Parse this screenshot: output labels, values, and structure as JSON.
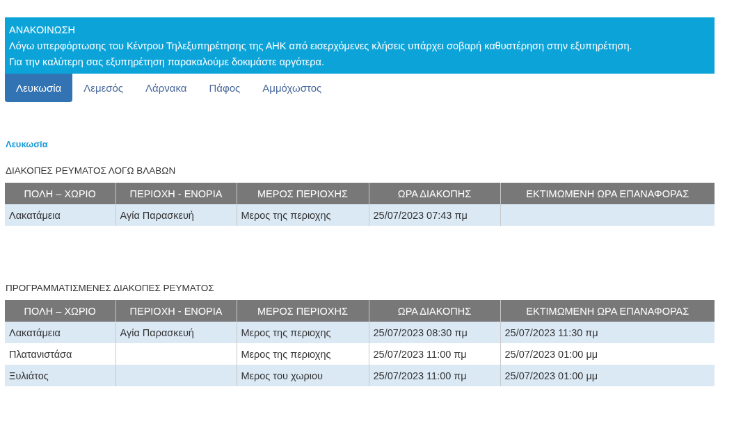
{
  "announcement": {
    "title": "ΑΝΑΚΟΙΝΩΣΗ",
    "lines": [
      "Λόγω υπερφόρτωσης του Κέντρου Τηλεξυπηρέτησης της ΑΗΚ από εισερχόμενες κλήσεις υπάρχει σοβαρή καθυστέρηση στην εξυπηρέτηση.",
      "Για την καλύτερη σας εξυπηρέτηση παρακαλούμε δοκιμάστε αργότερα."
    ]
  },
  "tabs": [
    {
      "label": "Λευκωσία",
      "selected": true
    },
    {
      "label": "Λεμεσός",
      "selected": false
    },
    {
      "label": "Λάρνακα",
      "selected": false
    },
    {
      "label": "Πάφος",
      "selected": false
    },
    {
      "label": "Αμμόχωστος",
      "selected": false
    }
  ],
  "section_title": "Λευκωσία",
  "tables": [
    {
      "title": "ΔΙΑΚΟΠΕΣ ΡΕΥΜΑΤΟΣ ΛΟΓΩ ΒΛΑΒΩΝ",
      "columns": [
        "ΠΟΛΗ – ΧΩΡΙΟ",
        "ΠΕΡΙΟΧΗ - ΕΝΟΡΙΑ",
        "ΜΕΡΟΣ ΠΕΡΙΟΧΗΣ",
        "ΩΡΑ ΔΙΑΚΟΠΗΣ",
        "ΕΚΤΙΜΩΜΕΝΗ ΩΡΑ ΕΠΑΝΑΦΟΡΑΣ"
      ],
      "rows": [
        [
          "Λακατάμεια",
          "Αγία Παρασκευή",
          "Μερος της περιοχης",
          "25/07/2023 07:43 πμ",
          null
        ]
      ]
    },
    {
      "title": "ΠΡΟΓΡΑΜΜΑΤΙΣΜΕΝΕΣ ΔΙΑΚΟΠΕΣ ΡΕΥΜΑΤΟΣ",
      "columns": [
        "ΠΟΛΗ – ΧΩΡΙΟ",
        "ΠΕΡΙΟΧΗ - ΕΝΟΡΙΑ",
        "ΜΕΡΟΣ ΠΕΡΙΟΧΗΣ",
        "ΩΡΑ ΔΙΑΚΟΠΗΣ",
        "ΕΚΤΙΜΩΜΕΝΗ ΩΡΑ ΕΠΑΝΑΦΟΡΑΣ"
      ],
      "rows": [
        [
          "Λακατάμεια",
          "Αγία Παρασκευή",
          "Μερος της περιοχης",
          "25/07/2023 08:30 πμ",
          "25/07/2023 11:30 πμ"
        ],
        [
          "Πλατανιστάσα",
          null,
          "Μερος της περιοχης",
          "25/07/2023 11:00 πμ",
          "25/07/2023 01:00 μμ"
        ],
        [
          "Ξυλιάτος",
          null,
          "Μερος του χωριου",
          "25/07/2023 11:00 πμ",
          "25/07/2023 01:00 μμ"
        ]
      ]
    }
  ]
}
